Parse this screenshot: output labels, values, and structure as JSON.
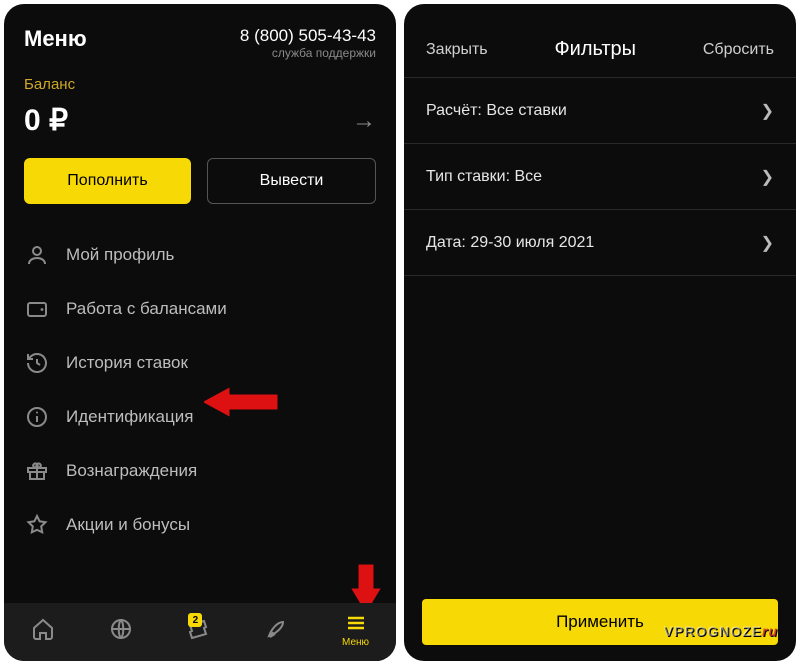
{
  "left": {
    "title": "Меню",
    "support_phone": "8 (800) 505-43-43",
    "support_sub": "служба поддержки",
    "balance_label": "Баланс",
    "balance_value": "0 ₽",
    "btn_topup": "Пополнить",
    "btn_withdraw": "Вывести",
    "menu": [
      {
        "icon": "profile",
        "label": "Мой профиль"
      },
      {
        "icon": "wallet",
        "label": "Работа с балансами"
      },
      {
        "icon": "history",
        "label": "История ставок"
      },
      {
        "icon": "info",
        "label": "Идентификация"
      },
      {
        "icon": "gift",
        "label": "Вознаграждения"
      },
      {
        "icon": "star",
        "label": "Акции и бонусы"
      }
    ],
    "nav": {
      "badge_count": "2",
      "menu_label": "Меню"
    }
  },
  "right": {
    "close": "Закрыть",
    "title": "Фильтры",
    "reset": "Сбросить",
    "rows": [
      "Расчёт: Все ставки",
      "Тип ставки: Все",
      "Дата: 29-30 июля 2021"
    ],
    "apply": "Применить"
  },
  "watermark": {
    "main": "VPROGNOZE",
    "suffix": "ru"
  }
}
